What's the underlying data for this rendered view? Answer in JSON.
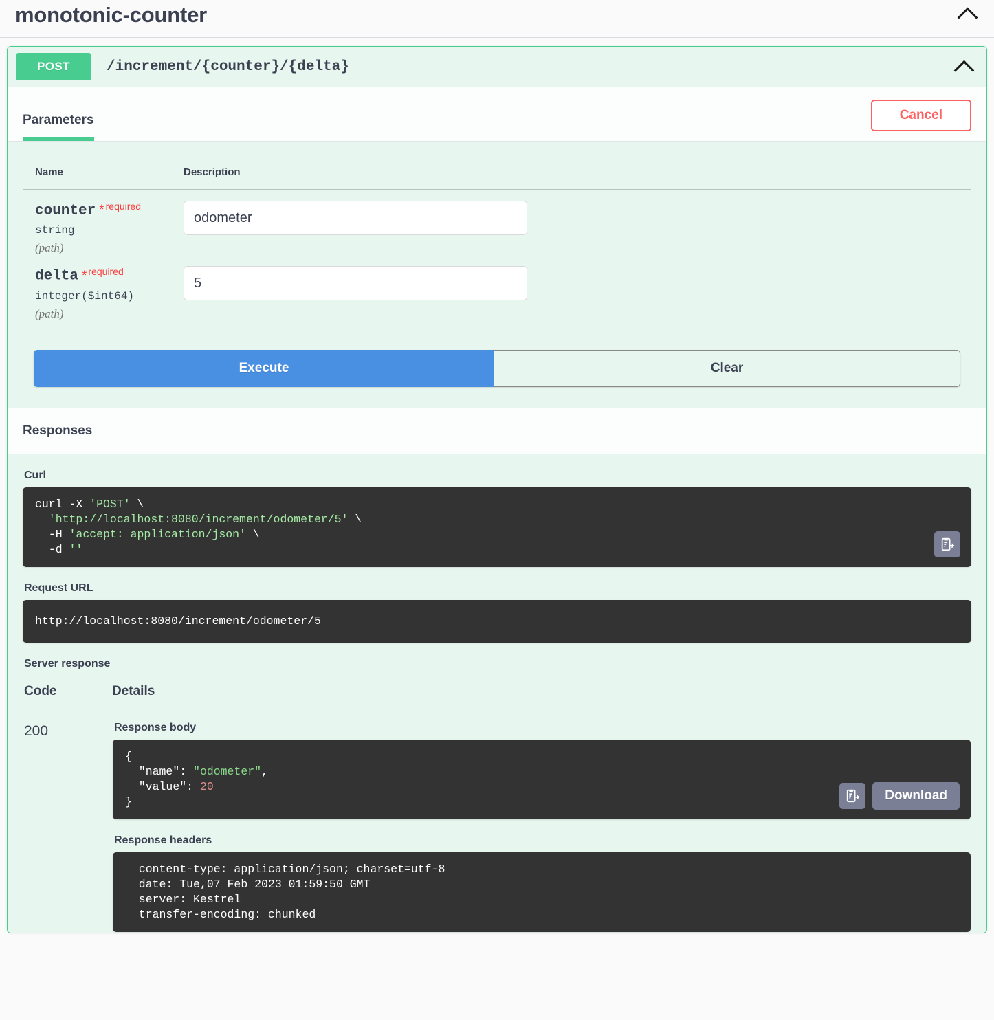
{
  "tag": {
    "title": "monotonic-counter",
    "collapse_icon": "chevron-up-icon"
  },
  "operation": {
    "method": "POST",
    "path": "/increment/{counter}/{delta}",
    "collapse_icon": "chevron-up-icon",
    "accent_color": "#49cc90"
  },
  "tabs": [
    {
      "label": "Parameters",
      "active": true
    }
  ],
  "cancel_button": {
    "label": "Cancel",
    "color": "#ff6060"
  },
  "parameters": {
    "headers": {
      "name": "Name",
      "description": "Description"
    },
    "rows": [
      {
        "name": "counter",
        "star": "*",
        "required": "required",
        "type": "string",
        "in": "(path)",
        "value": "odometer",
        "placeholder": "counter"
      },
      {
        "name": "delta",
        "star": "*",
        "required": "required",
        "type": "integer($int64)",
        "in": "(path)",
        "value": "5",
        "placeholder": "delta"
      }
    ]
  },
  "actions": {
    "execute_label": "Execute",
    "clear_label": "Clear",
    "execute_color": "#4990e2"
  },
  "responses": {
    "section_title": "Responses",
    "curl_label": "Curl",
    "curl": {
      "line1_cmd": "curl -X ",
      "line1_method": "'POST'",
      "line1_tail": " \\",
      "line2": "  'http://localhost:8080/increment/odometer/5'",
      "line2_tail": " \\",
      "line3_flag": "  -H ",
      "line3_val": "'accept: application/json'",
      "line3_tail": " \\",
      "line4_flag": "  -d ",
      "line4_val": "''"
    },
    "copy_icon": "copy-to-clipboard-icon",
    "request_url_label": "Request URL",
    "request_url": "http://localhost:8080/increment/odometer/5",
    "server_response_label": "Server response",
    "table_headers": {
      "code": "Code",
      "details": "Details"
    },
    "status_code": "200",
    "response_body_label": "Response body",
    "response_body": {
      "open_brace": "{",
      "name_key": "\"name\"",
      "name_sep": ": ",
      "name_value": "\"odometer\"",
      "name_comma": ",",
      "value_key": "\"value\"",
      "value_sep": ": ",
      "value_value": "20",
      "close_brace": "}"
    },
    "download_label": "Download",
    "response_headers_label": "Response headers",
    "response_headers": "  content-type: application/json; charset=utf-8\n  date: Tue,07 Feb 2023 01:59:50 GMT\n  server: Kestrel\n  transfer-encoding: chunked"
  }
}
